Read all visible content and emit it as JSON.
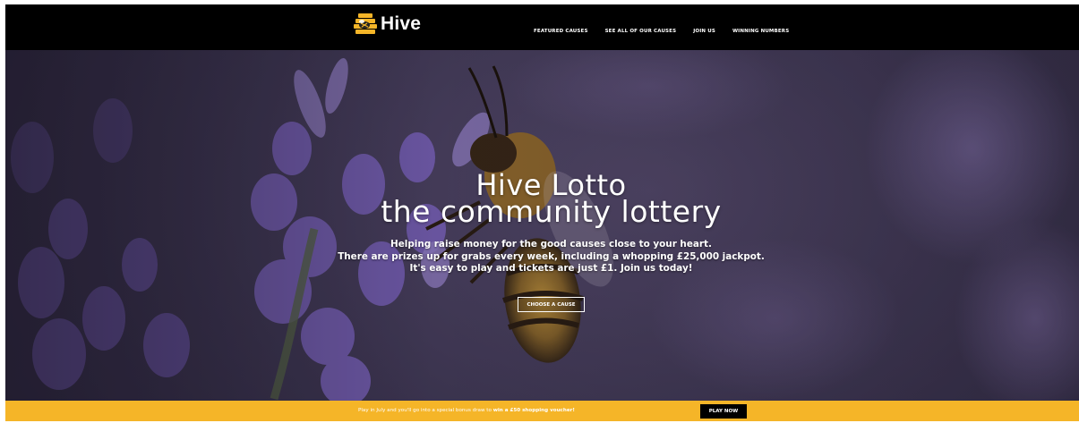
{
  "header": {
    "logo_text": "Hive",
    "nav": [
      {
        "label": "FEATURED CAUSES"
      },
      {
        "label": "SEE ALL OF OUR CAUSES"
      },
      {
        "label": "JOIN US"
      },
      {
        "label": "WINNING NUMBERS"
      }
    ]
  },
  "hero": {
    "title_line1": "Hive Lotto",
    "title_line2": "the community lottery",
    "description_line1": "Helping raise money for the good causes close to your heart.",
    "description_line2": "There are prizes up for grabs every week, including a whopping £25,000 jackpot.",
    "description_line3": "It's easy to play and tickets are just £1. Join us today!",
    "cta_label": "CHOOSE A CAUSE"
  },
  "banner": {
    "text_prefix": "Play in July and you'll go into a special bonus draw to ",
    "text_bold": "win a £50 shopping voucher!",
    "button_label": "PLAY NOW"
  },
  "colors": {
    "brand_yellow": "#f5b528",
    "header_bg": "#000000",
    "hero_purple": "#4a4263"
  },
  "icons": {
    "logo": "bee-hive-logo-icon"
  }
}
